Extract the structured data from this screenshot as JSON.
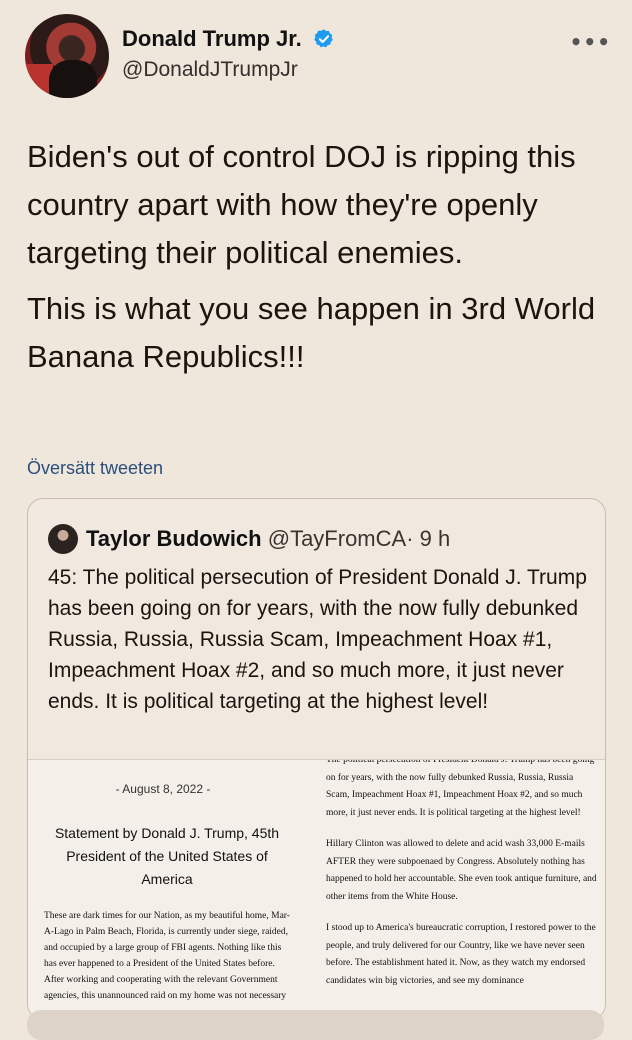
{
  "author": {
    "name": "Donald Trump Jr.",
    "handle": "@DonaldJTrumpJr",
    "verified": true,
    "more_icon": "more-horizontal-icon"
  },
  "tweet": {
    "paragraphs": [
      "Biden's out of control DOJ is ripping this country apart with how they're openly targeting their political enemies.",
      "This is what you see happen in 3rd World Banana Republics!!!"
    ],
    "translate_label": "Översätt tweeten"
  },
  "quote": {
    "name": "Taylor Budowich",
    "handle": "@TayFromCA",
    "time": "· 9 h",
    "text": "45: The political persecution of President Donald J. Trump has been going on for years, with the now fully debunked Russia, Russia, Russia Scam, Impeachment Hoax #1, Impeachment Hoax #2, and so much more, it just never ends. It is political targeting at the highest level!",
    "doc": {
      "date": "- August 8, 2022 -",
      "title": "Statement by Donald J. Trump, 45th President of the United States of America",
      "body_left": "These are dark times for our Nation, as my beautiful home, Mar-A-Lago in Palm Beach, Florida, is currently under siege, raided, and occupied by a large group of FBI agents. Nothing like this has ever happened to a President of the United States before. After working and cooperating with the relevant Government agencies, this unannounced raid on my home was not necessary",
      "right_p1": "The political persecution of President Donald J. Trump has been going on for years, with the now fully debunked Russia, Russia, Russia Scam, Impeachment Hoax #1, Impeachment Hoax #2, and so much more, it just never ends. It is political targeting at the highest level!",
      "right_p2": "Hillary Clinton was allowed to delete and acid wash 33,000 E-mails AFTER they were subpoenaed by Congress. Absolutely nothing has happened to hold her accountable. She even took antique furniture, and other items from the White House.",
      "right_p3": "I stood up to America's bureaucratic corruption, I restored power to the people, and truly delivered for our Country, like we have never seen before. The establishment hated it. Now, as they watch my endorsed candidates win big victories, and see my dominance"
    }
  },
  "colors": {
    "background": "#efe6dc",
    "verified_badge": "#1d9bf0",
    "link": "#2a4f7a"
  }
}
